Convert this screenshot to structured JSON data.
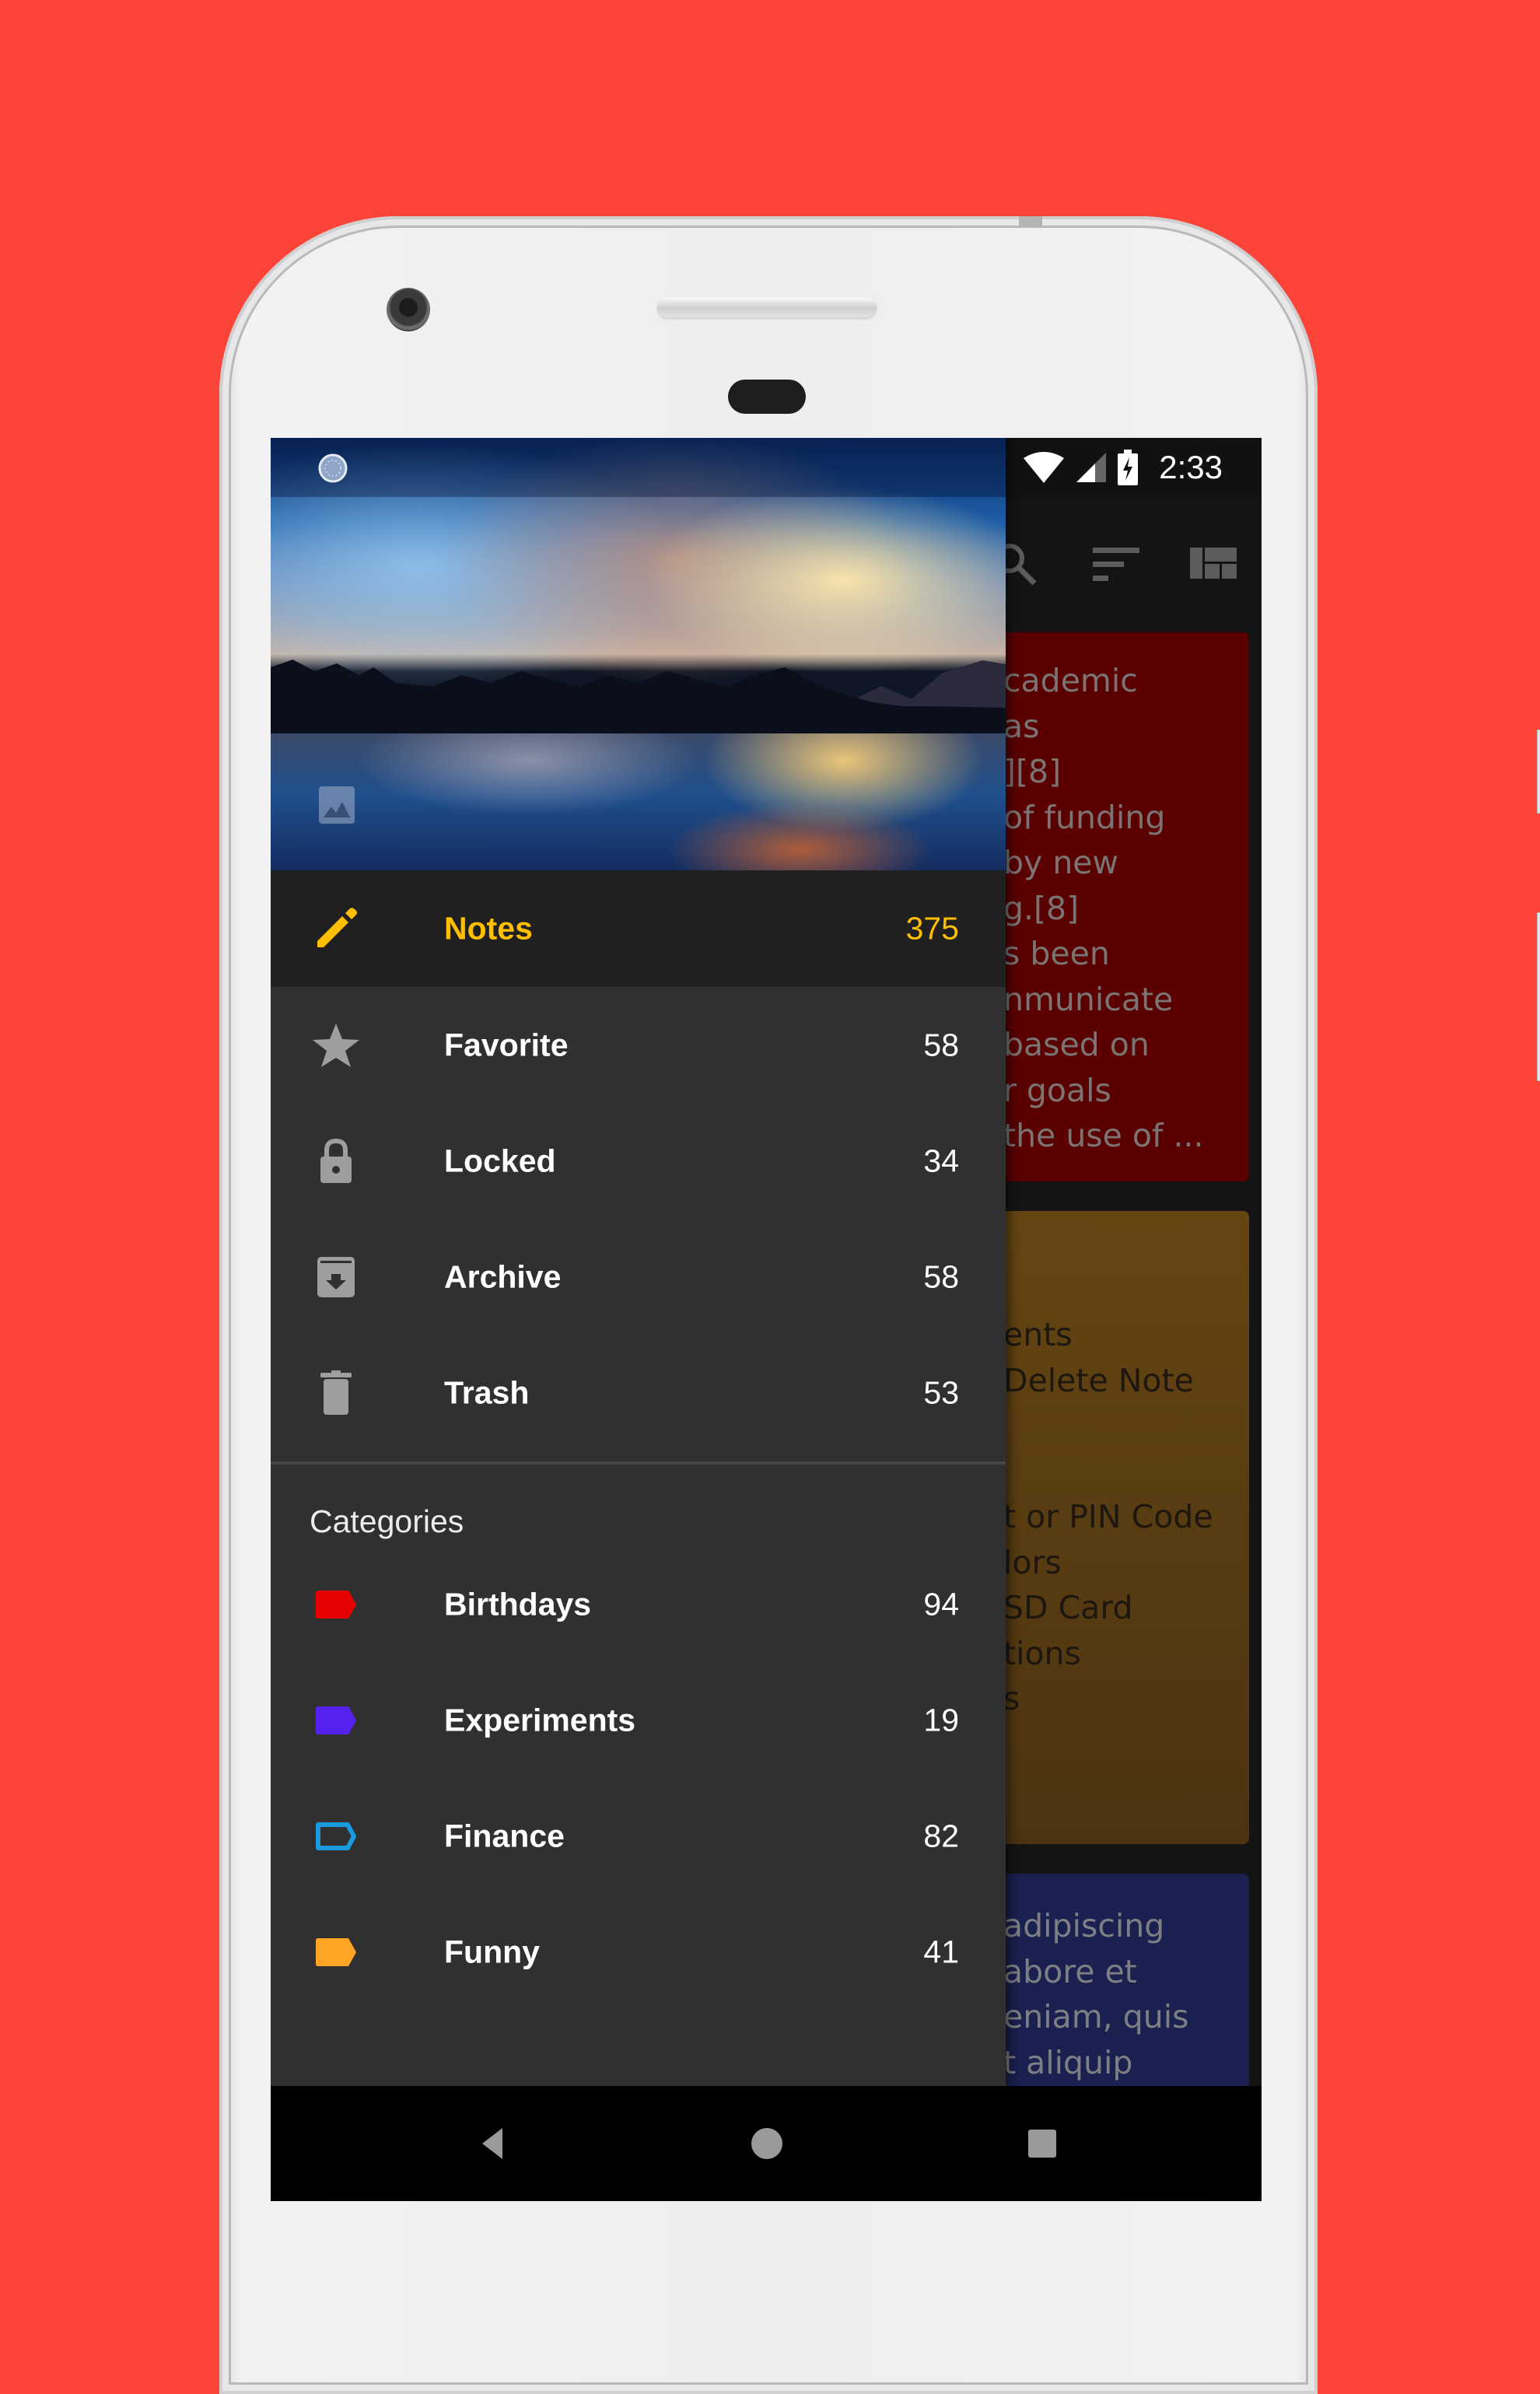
{
  "status_bar": {
    "time": "2:33",
    "icons": [
      "sync-icon",
      "wifi-icon",
      "signal-icon",
      "battery-charging-icon"
    ]
  },
  "toolbar": {
    "icons": [
      "search-icon",
      "sort-icon",
      "layout-icon"
    ]
  },
  "drawer": {
    "header_icons": [
      "sync-icon",
      "image-icon"
    ],
    "items": [
      {
        "label": "Notes",
        "count": "375",
        "icon": "pencil-icon",
        "active": true
      },
      {
        "label": "Favorite",
        "count": "58",
        "icon": "star-icon"
      },
      {
        "label": "Locked",
        "count": "34",
        "icon": "lock-icon"
      },
      {
        "label": "Archive",
        "count": "58",
        "icon": "archive-icon"
      },
      {
        "label": "Trash",
        "count": "53",
        "icon": "trash-icon"
      }
    ],
    "categories_label": "Categories",
    "categories": [
      {
        "label": "Birthdays",
        "count": "94",
        "color": "#e60000",
        "outlined": false
      },
      {
        "label": "Experiments",
        "count": "19",
        "color": "#5522f0",
        "outlined": false
      },
      {
        "label": "Finance",
        "count": "82",
        "color": "#1a9be0",
        "outlined": true
      },
      {
        "label": "Funny",
        "count": "41",
        "color": "#ffa526",
        "outlined": false
      }
    ]
  },
  "colors": {
    "accent": "#ffbf00",
    "background": "#fd4438",
    "drawer": "#303030",
    "drawer_active": "#202020"
  },
  "notes": [
    {
      "color": "#5a0000",
      "visible_lines": [
        "cademic",
        "as",
        "][8]",
        "of funding",
        "  by new",
        "g.[8]",
        "s been",
        "nmunicate",
        "based on",
        "r goals",
        "  the use of ..."
      ]
    },
    {
      "color": "#654512",
      "visible_lines": [
        "",
        "",
        "",
        "ents",
        "Delete Note",
        "",
        "",
        "t or PIN Code",
        "lors",
        " SD Card",
        "tions",
        "s"
      ]
    },
    {
      "color": "#1a204f",
      "visible_lines": [
        "adipiscing",
        "abore et",
        "eniam, quis",
        "t aliquip"
      ]
    }
  ],
  "system_nav": [
    "back-button",
    "home-button",
    "recents-button"
  ]
}
